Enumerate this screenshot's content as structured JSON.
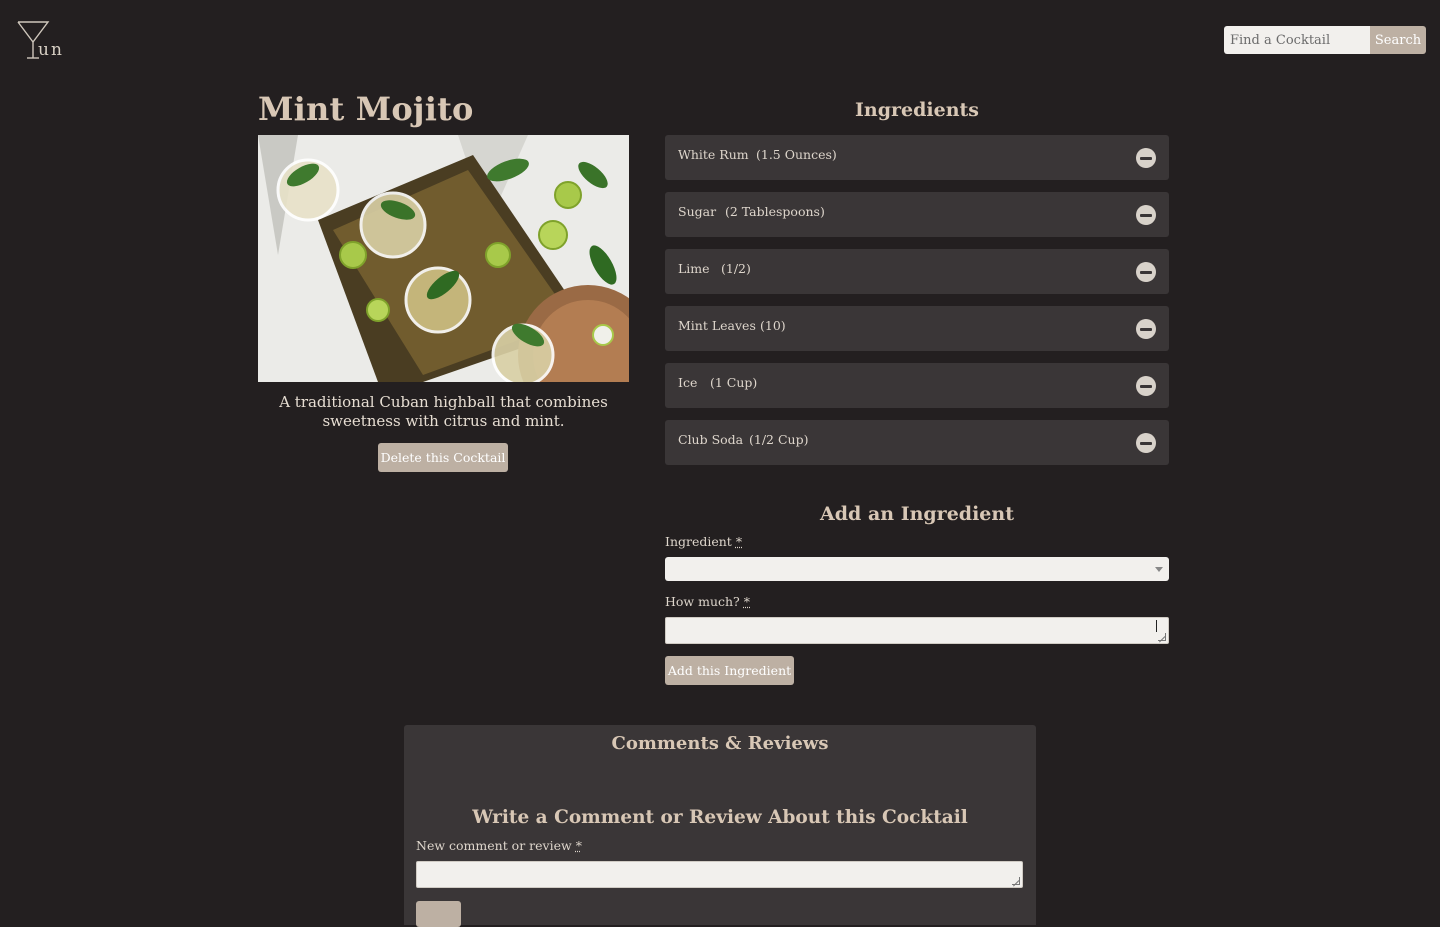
{
  "header": {
    "logo_text": "un",
    "search_placeholder": "Find a Cocktail",
    "search_button_label": "Search"
  },
  "cocktail": {
    "title": "Mint Mojito",
    "description": "A traditional Cuban highball that combines sweetness with citrus and mint.",
    "delete_label": "Delete this Cocktail"
  },
  "ingredients": {
    "heading": "Ingredients",
    "items": [
      {
        "name": "White Rum",
        "qty": "(1.5 Ounces)"
      },
      {
        "name": "Sugar",
        "qty": "(2 Tablespoons)"
      },
      {
        "name": "Lime",
        "qty": "(1/2)"
      },
      {
        "name": "Mint Leaves",
        "qty": "(10)"
      },
      {
        "name": "Ice",
        "qty": "(1 Cup)"
      },
      {
        "name": "Club Soda",
        "qty": "(1/2 Cup)"
      }
    ]
  },
  "add_ingredient": {
    "heading": "Add an Ingredient",
    "ingredient_label": "Ingredient",
    "amount_label": "How much?",
    "required_mark": "*",
    "submit_label": "Add this Ingredient"
  },
  "comments": {
    "heading": "Comments & Reviews",
    "write_heading": "Write a Comment or Review About this Cocktail",
    "new_comment_label": "New comment or review"
  },
  "colors": {
    "background": "#231f20",
    "panel": "#3a3637",
    "accent_button": "#bdb0a3",
    "heading": "#d8c7b5"
  }
}
